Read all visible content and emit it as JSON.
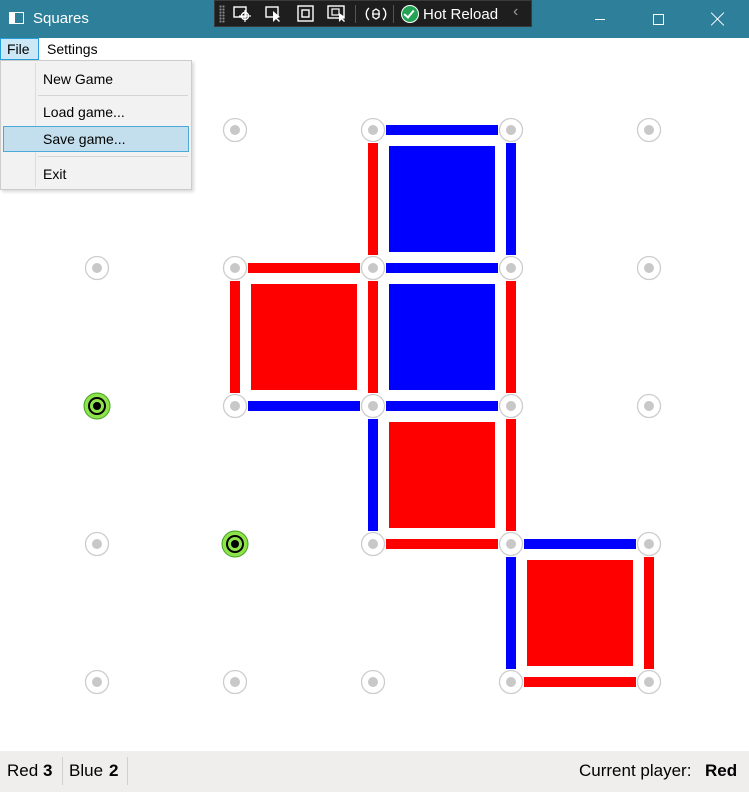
{
  "window": {
    "title": "Squares"
  },
  "devbar": {
    "hot_reload_label": "Hot Reload",
    "collapse_glyph": "‹"
  },
  "menu": {
    "file": "File",
    "settings": "Settings",
    "file_items": [
      "New Game",
      "Load game...",
      "Save game...",
      "Exit"
    ],
    "selected_item": "Save game..."
  },
  "colors": {
    "red": "#ff0000",
    "blue": "#0000ff",
    "titlebar": "#2e7f9a",
    "highlight_dot": "#8fe34a"
  },
  "board": {
    "columns": 5,
    "rows": 5,
    "lines": [
      {
        "from": [
          2,
          0
        ],
        "to": [
          3,
          0
        ],
        "color": "blue"
      },
      {
        "from": [
          2,
          0
        ],
        "to": [
          2,
          1
        ],
        "color": "red"
      },
      {
        "from": [
          3,
          0
        ],
        "to": [
          3,
          1
        ],
        "color": "blue"
      },
      {
        "from": [
          1,
          1
        ],
        "to": [
          2,
          1
        ],
        "color": "red"
      },
      {
        "from": [
          2,
          1
        ],
        "to": [
          3,
          1
        ],
        "color": "blue"
      },
      {
        "from": [
          1,
          1
        ],
        "to": [
          1,
          2
        ],
        "color": "red"
      },
      {
        "from": [
          2,
          1
        ],
        "to": [
          2,
          2
        ],
        "color": "red"
      },
      {
        "from": [
          3,
          1
        ],
        "to": [
          3,
          2
        ],
        "color": "red"
      },
      {
        "from": [
          1,
          2
        ],
        "to": [
          2,
          2
        ],
        "color": "blue"
      },
      {
        "from": [
          2,
          2
        ],
        "to": [
          3,
          2
        ],
        "color": "blue"
      },
      {
        "from": [
          2,
          2
        ],
        "to": [
          2,
          3
        ],
        "color": "blue"
      },
      {
        "from": [
          3,
          2
        ],
        "to": [
          3,
          3
        ],
        "color": "red"
      },
      {
        "from": [
          2,
          3
        ],
        "to": [
          3,
          3
        ],
        "color": "red"
      },
      {
        "from": [
          3,
          3
        ],
        "to": [
          4,
          3
        ],
        "color": "blue"
      },
      {
        "from": [
          3,
          3
        ],
        "to": [
          3,
          4
        ],
        "color": "blue"
      },
      {
        "from": [
          4,
          3
        ],
        "to": [
          4,
          4
        ],
        "color": "red"
      },
      {
        "from": [
          3,
          4
        ],
        "to": [
          4,
          4
        ],
        "color": "red"
      }
    ],
    "squares": [
      {
        "col": 2,
        "row": 0,
        "owner": "blue"
      },
      {
        "col": 1,
        "row": 1,
        "owner": "red"
      },
      {
        "col": 2,
        "row": 1,
        "owner": "blue"
      },
      {
        "col": 2,
        "row": 2,
        "owner": "red"
      },
      {
        "col": 3,
        "row": 3,
        "owner": "red"
      }
    ],
    "highlighted_dots": [
      [
        0,
        2
      ],
      [
        1,
        3
      ]
    ]
  },
  "status": {
    "red_label": "Red",
    "red_score": "3",
    "blue_label": "Blue",
    "blue_score": "2",
    "current_player_label": "Current player:",
    "current_player": "Red"
  }
}
